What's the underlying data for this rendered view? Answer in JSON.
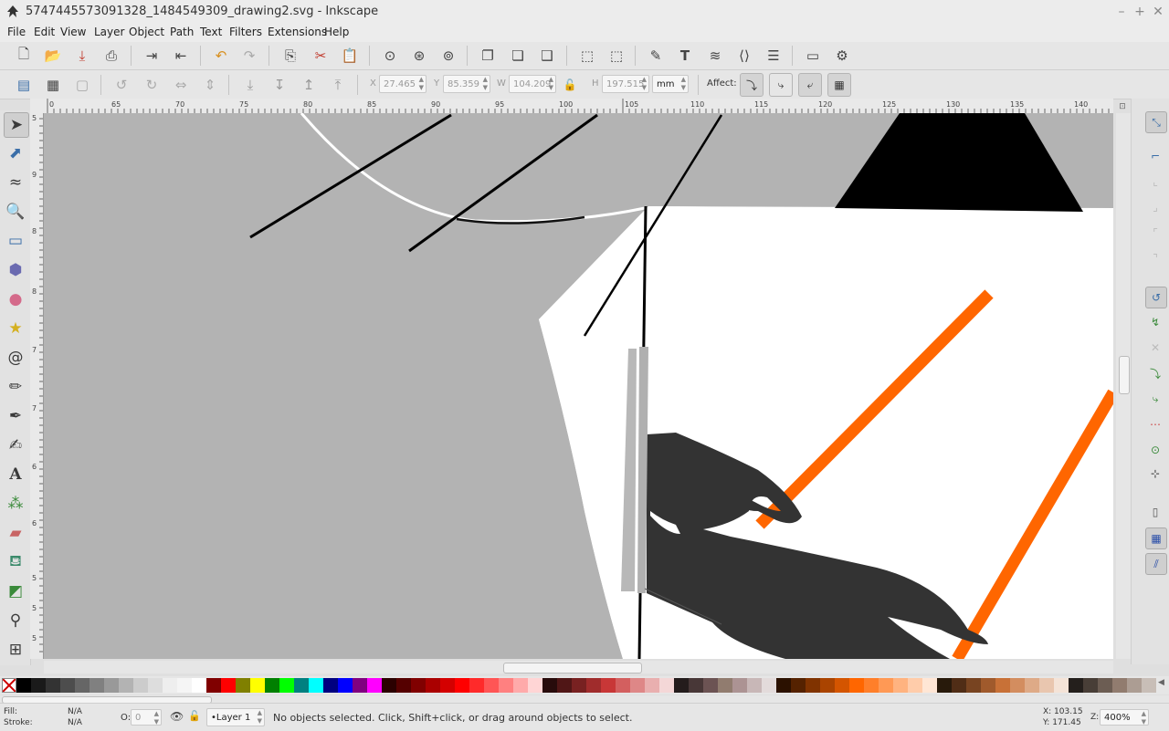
{
  "window": {
    "title": "5747445573091328_1484549309_drawing2.svg - Inkscape",
    "controls": [
      "–",
      "+",
      "✕"
    ]
  },
  "menu": [
    "File",
    "Edit",
    "View",
    "Layer",
    "Object",
    "Path",
    "Text",
    "Filters",
    "Extensions",
    "Help"
  ],
  "tool_controls": {
    "x_label": "X",
    "x_value": "27.465",
    "y_label": "Y",
    "y_value": "85.359",
    "w_label": "W",
    "w_value": "104.209",
    "h_label": "H",
    "h_value": "197.515",
    "unit": "mm",
    "affect_label": "Affect:"
  },
  "hruler_ticks": [
    "0",
    "65",
    "70",
    "75",
    "80",
    "85",
    "90",
    "95",
    "100",
    "105",
    "110",
    "115",
    "120",
    "125",
    "130",
    "135",
    "140"
  ],
  "vruler_ticks": [
    "5",
    "9",
    "8",
    "8",
    "7",
    "7",
    "6",
    "6",
    "5",
    "5",
    "5"
  ],
  "palette": [
    "#000000",
    "#1a1a1a",
    "#333333",
    "#4d4d4d",
    "#666666",
    "#808080",
    "#999999",
    "#b3b3b3",
    "#cccccc",
    "#dddddd",
    "#eeeeee",
    "#f5f5f5",
    "#ffffff",
    "#800000",
    "#ff0000",
    "#808000",
    "#ffff00",
    "#008000",
    "#00ff00",
    "#008080",
    "#00ffff",
    "#000080",
    "#0000ff",
    "#800080",
    "#ff00ff",
    "#2b0000",
    "#550000",
    "#800000",
    "#aa0000",
    "#d40000",
    "#ff0000",
    "#ff2a2a",
    "#ff5555",
    "#ff8080",
    "#ffaaaa",
    "#ffd5d5",
    "#280b0b",
    "#501616",
    "#782121",
    "#a02c2c",
    "#c83737",
    "#d35f5f",
    "#de8787",
    "#e9afaf",
    "#f4d7d7",
    "#241c1c",
    "#483737",
    "#6c5353",
    "#917c6f",
    "#ac9393",
    "#c8b7b7",
    "#e3dbdb",
    "#2b1100",
    "#552200",
    "#803300",
    "#aa4400",
    "#d45500",
    "#ff6600",
    "#ff7f2a",
    "#ff9955",
    "#ffb380",
    "#ffccaa",
    "#ffe6d5",
    "#281a0b",
    "#502d16",
    "#784421",
    "#a05a2c",
    "#c87137",
    "#d38d5f",
    "#deaa87",
    "#e9c6af",
    "#f4e3d7",
    "#241f1c",
    "#483e37",
    "#6c5d53",
    "#917c6f",
    "#ac9d93",
    "#c8beb7"
  ],
  "status": {
    "fill_label": "Fill:",
    "fill_value": "N/A",
    "stroke_label": "Stroke:",
    "stroke_value": "N/A",
    "opacity_label": "O:",
    "opacity_value": "0",
    "layer": "•Layer 1",
    "message": "No objects selected. Click, Shift+click, or drag around objects to select.",
    "x_coord": "X: 103.15",
    "y_coord": "Y: 171.45",
    "zoom_label": "Z:",
    "zoom": "400%"
  },
  "colors": {
    "canvas_gray": "#b3b3b3",
    "orange": "#ff6600",
    "hand": "#333333",
    "accent": "#3a6ea8"
  }
}
